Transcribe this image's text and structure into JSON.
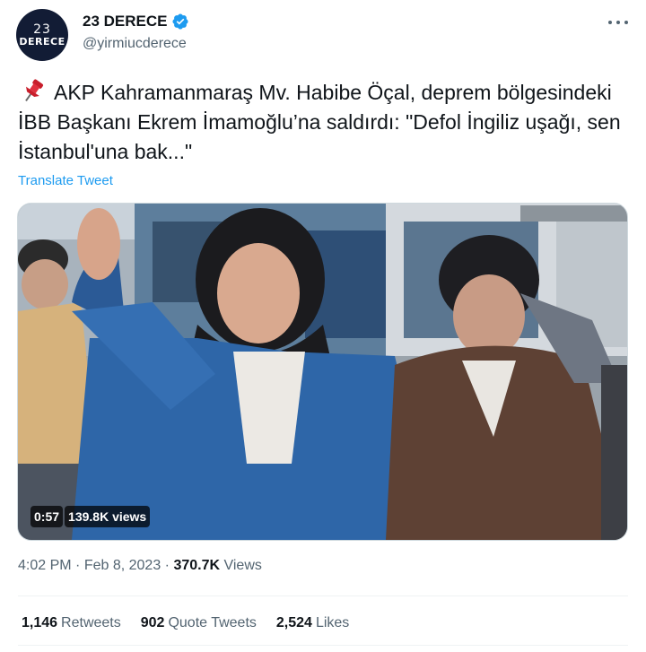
{
  "author": {
    "avatar_text_top": "23",
    "avatar_text_bottom": "DERECE",
    "display_name": "23 DERECE",
    "handle": "@yirmiucderece",
    "verified_icon": "verified-badge-icon"
  },
  "tweet": {
    "text": "AKP Kahramanmaraş Mv. Habibe Öçal, deprem bölgesindeki İBB Başkanı Ekrem İmamoğlu’na saldırdı: \"Defol İngiliz uşağı, sen İstanbul'una bak...\"",
    "leading_icon": "pushpin-icon",
    "translate_label": "Translate Tweet"
  },
  "media": {
    "duration": "0:57",
    "views_badge": "139.8K views"
  },
  "meta": {
    "time": "4:02 PM",
    "sep1": " · ",
    "date": "Feb 8, 2023",
    "sep2": " · ",
    "views_count": "370.7K",
    "views_label": " Views"
  },
  "stats": [
    {
      "count": "1,146",
      "label": "Retweets"
    },
    {
      "count": "902",
      "label": "Quote Tweets"
    },
    {
      "count": "2,524",
      "label": "Likes"
    }
  ],
  "colors": {
    "accent": "#1d9bf0",
    "secondary_text": "#536471",
    "primary_text": "#0f1419"
  }
}
